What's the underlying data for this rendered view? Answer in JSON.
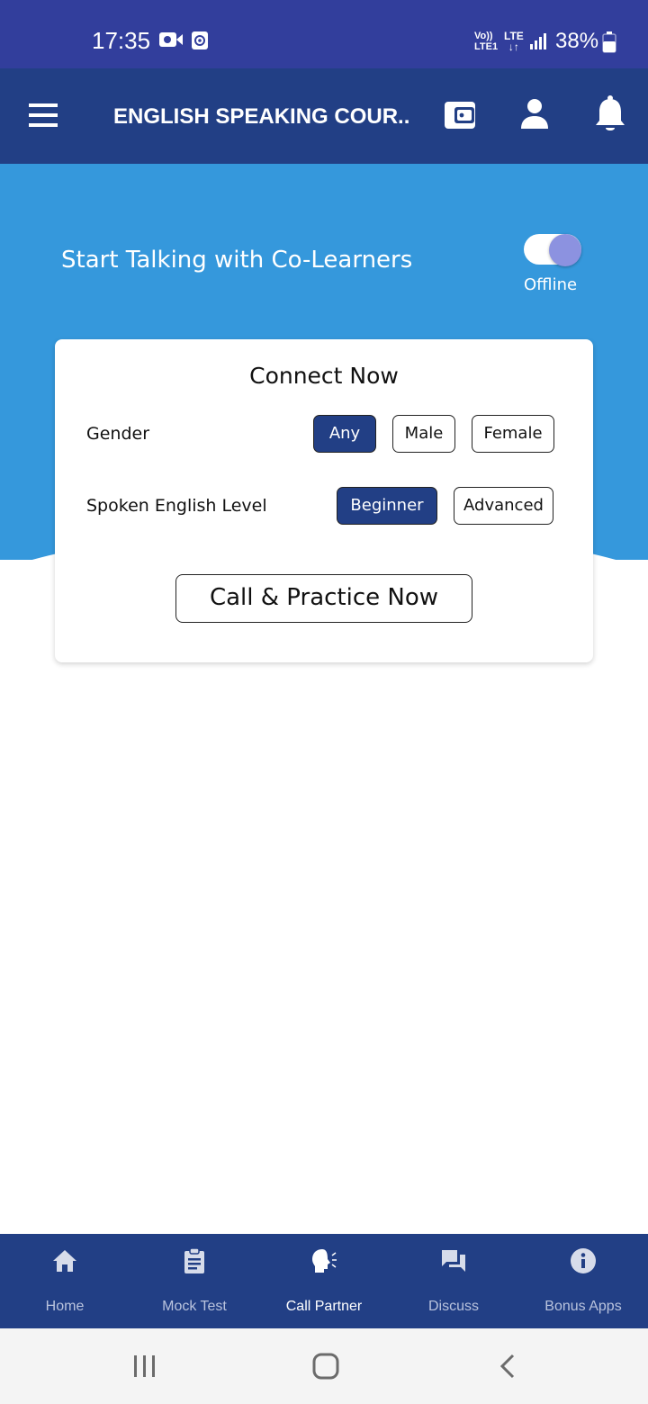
{
  "status_bar": {
    "time": "17:35",
    "volte_line1": "Vo))",
    "volte_line2": "LTE1",
    "lte_line1": "LTE",
    "lte_line2": "↓↑",
    "battery": "38%"
  },
  "app_bar": {
    "title": "ENGLISH SPEAKING COUR..."
  },
  "hero": {
    "title": "Start Talking with Co-Learners",
    "toggle_label": "Offline",
    "toggle_on": true
  },
  "card": {
    "title": "Connect Now",
    "gender": {
      "label": "Gender",
      "options": [
        "Any",
        "Male",
        "Female"
      ],
      "selected": "Any"
    },
    "level": {
      "label": "Spoken English Level",
      "options": [
        "Beginner",
        "Advanced"
      ],
      "selected": "Beginner"
    },
    "call_button": "Call & Practice Now"
  },
  "bottom_nav": {
    "items": [
      {
        "label": "Home",
        "icon": "home-icon"
      },
      {
        "label": "Mock Test",
        "icon": "clipboard-icon"
      },
      {
        "label": "Call Partner",
        "icon": "speaking-head-icon"
      },
      {
        "label": "Discuss",
        "icon": "chat-icon"
      },
      {
        "label": "Bonus Apps",
        "icon": "info-icon"
      }
    ],
    "active": "Call Partner"
  },
  "colors": {
    "status_bar": "#323e9c",
    "app_bar": "#223f85",
    "hero": "#3598dc",
    "selected_button": "#223f85",
    "toggle_knob": "#8c92e0"
  }
}
